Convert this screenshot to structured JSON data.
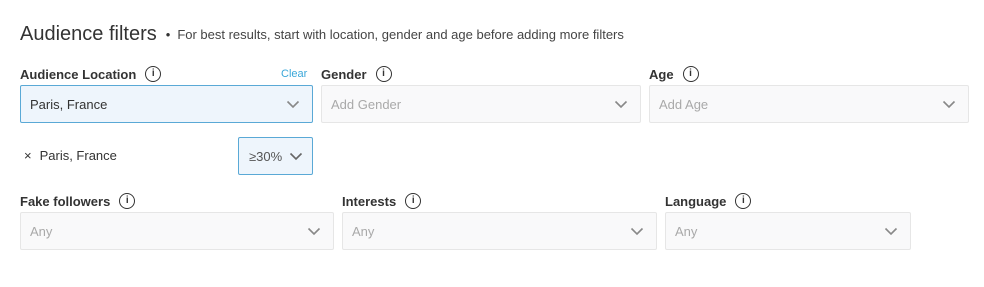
{
  "header": {
    "title": "Audience filters",
    "bullet": "•",
    "subtitle": "For best results, start with location, gender and age before adding more filters"
  },
  "filters": {
    "location": {
      "label": "Audience Location",
      "clear_label": "Clear",
      "value": "Paris, France"
    },
    "gender": {
      "label": "Gender",
      "placeholder": "Add Gender"
    },
    "age": {
      "label": "Age",
      "placeholder": "Add Age"
    },
    "location_chip": {
      "remove_glyph": "×",
      "label": "Paris, France",
      "weight": "≥30%"
    },
    "fake_followers": {
      "label": "Fake followers",
      "placeholder": "Any"
    },
    "interests": {
      "label": "Interests",
      "placeholder": "Any"
    },
    "language": {
      "label": "Language",
      "placeholder": "Any"
    }
  },
  "icons": {
    "info": "info-icon",
    "dropdown": "chevron-down-icon",
    "remove": "close-icon"
  },
  "colors": {
    "accent": "#3aa7d9",
    "active_border": "#5aa9d6",
    "active_bg": "#eef5fc",
    "input_bg": "#f9f9fa",
    "input_border": "#e6e6e6"
  }
}
